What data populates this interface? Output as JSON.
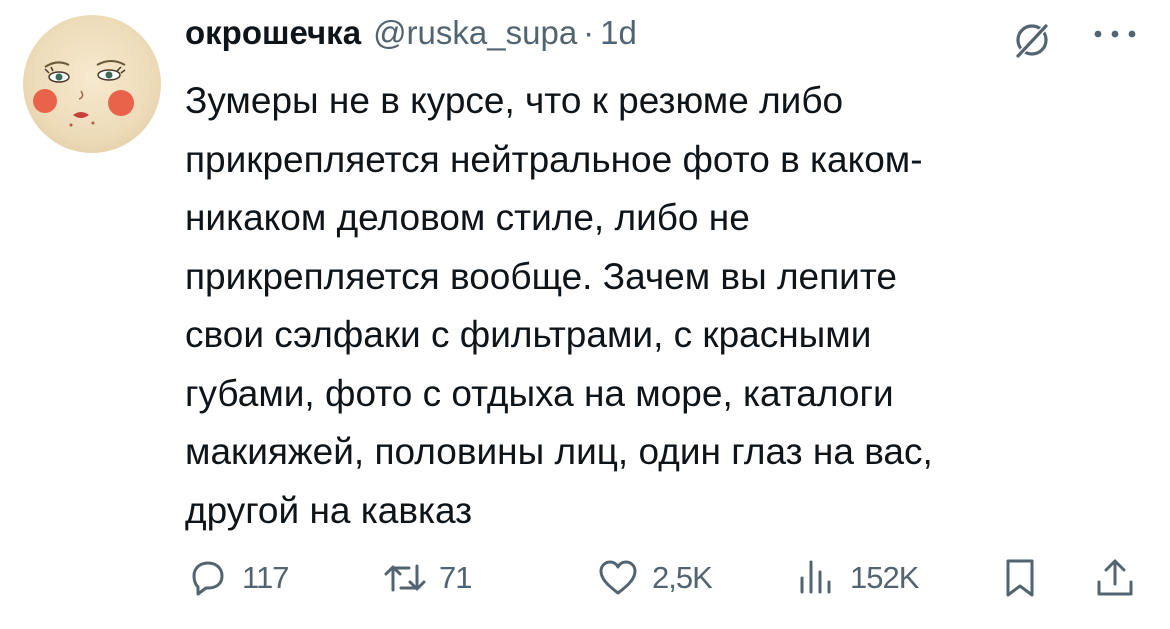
{
  "author": {
    "display_name": "окрошечка",
    "handle": "@ruska_supa",
    "separator": "·",
    "timestamp": "1d"
  },
  "tweet": {
    "lines": [
      "Зумеры не в курсе, что к резюме либо",
      "прикрепляется нейтральное фото в каком-",
      "никаком деловом стиле, либо не",
      "прикрепляется вообще. Зачем вы лепите",
      "свои сэлфаки с фильтрами, с красными",
      "губами, фото с отдыха на море, каталоги",
      "макияжей, половины лиц, один глаз на вас,",
      "другой на кавказ"
    ]
  },
  "actions": {
    "replies": "117",
    "retweets": "71",
    "likes": "2,5K",
    "views": "152K"
  },
  "icons": {
    "avatar": "cartoon-face-avatar",
    "grok": "grok-icon",
    "more": "more-icon",
    "reply": "reply-icon",
    "retweet": "retweet-icon",
    "like": "heart-icon",
    "views": "views-icon",
    "bookmark": "bookmark-icon",
    "share": "share-icon"
  },
  "colors": {
    "text": "#0f1419",
    "secondary": "#536471",
    "background": "#ffffff"
  }
}
